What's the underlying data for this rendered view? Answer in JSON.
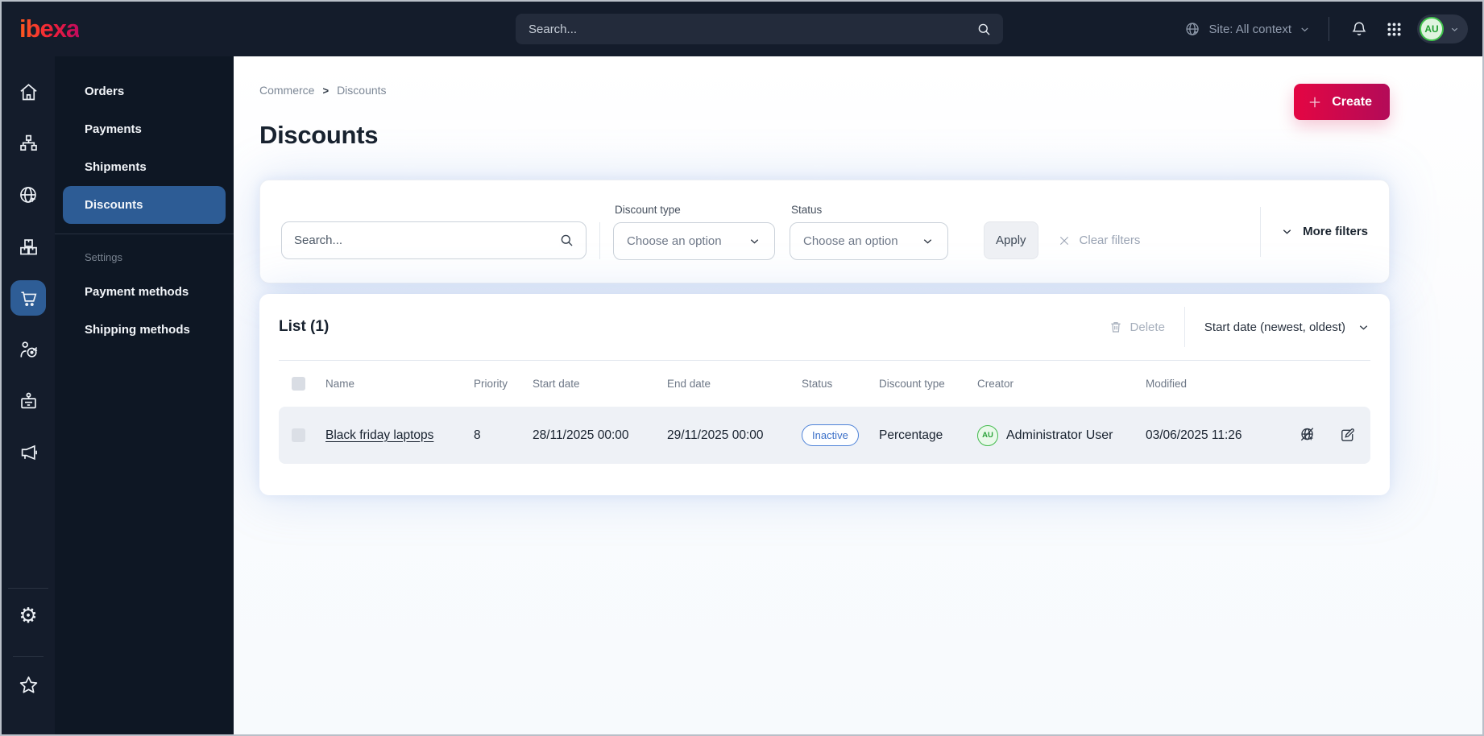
{
  "topbar": {
    "logo_text": "ibexa",
    "search_placeholder": "Search...",
    "site_context_label": "Site: All context",
    "avatar_initials": "AU"
  },
  "nav_rail": {
    "icons": [
      "home-icon",
      "content-tree-icon",
      "site-globe-icon",
      "products-boxes-icon",
      "commerce-cart-icon",
      "customers-target-icon",
      "corporate-badge-icon",
      "marketing-megaphone-icon",
      "gear-icon",
      "star-icon"
    ],
    "selected_icon": "commerce-cart-icon"
  },
  "sidebar": {
    "items": [
      "Orders",
      "Payments",
      "Shipments",
      "Discounts"
    ],
    "selected": "Discounts",
    "section_label": "Settings",
    "settings_items": [
      "Payment methods",
      "Shipping methods"
    ]
  },
  "breadcrumb": {
    "items": [
      "Commerce",
      "Discounts"
    ],
    "separator": ">"
  },
  "page": {
    "title": "Discounts",
    "create_button": "Create"
  },
  "filters": {
    "search_placeholder": "Search...",
    "fields": [
      {
        "label": "Discount type",
        "value": "Choose an option"
      },
      {
        "label": "Status",
        "value": "Choose an option"
      }
    ],
    "apply_label": "Apply",
    "clear_label": "Clear filters",
    "more_label": "More filters"
  },
  "list": {
    "title": "List (1)",
    "delete_label": "Delete",
    "sort_label": "Start date (newest, oldest)",
    "columns": [
      "Name",
      "Priority",
      "Start date",
      "End date",
      "Status",
      "Discount type",
      "Creator",
      "Modified"
    ],
    "rows": [
      {
        "name": "Black friday laptops",
        "priority": "8",
        "start_date": "28/11/2025 00:00",
        "end_date": "29/11/2025 00:00",
        "status": "Inactive",
        "discount_type": "Percentage",
        "creator_initials": "AU",
        "creator_name": "Administrator User",
        "modified": "03/06/2025 11:26"
      }
    ]
  },
  "icons_legend": {
    "search-icon": "magnifier",
    "bell-icon": "notifications",
    "app-grid-icon": "3x3 dots launcher",
    "chevron-down-icon": "dropdown caret",
    "trash-icon": "delete",
    "clear-x-icon": "clear filters",
    "plus-icon": "create",
    "preview-disabled-icon": "globe with slash and cursor",
    "edit-icon": "pencil in square"
  },
  "colors": {
    "topbar_bg": "#141c2b",
    "sidebar_bg": "#0e1724",
    "selected_blue": "#2d5c95",
    "accent_crimson": "#e40643",
    "accent_crimson_dark": "#b30b58",
    "status_inactive_blue": "#3a6fc8",
    "avatar_green": "#3fc14b",
    "row_bg": "#eef1f6"
  }
}
